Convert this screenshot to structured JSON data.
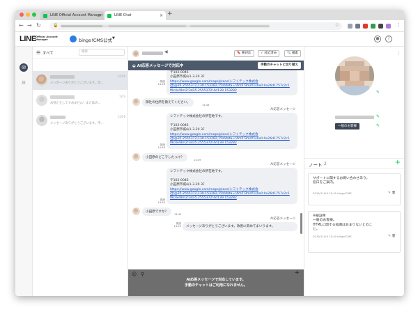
{
  "browser": {
    "tabs": [
      {
        "label": "LINE Official Account Manager"
      },
      {
        "label": "LINE Chat"
      }
    ],
    "new_tab_label": "+",
    "traffic_colors": [
      "#fe5f57",
      "#febc2e",
      "#28c840"
    ]
  },
  "app": {
    "logo": "LINE",
    "logo_sub_1": "Official Account",
    "logo_sub_2": "Manager",
    "account_name": "bingo!CMS公式",
    "account_caret": "▼",
    "accent": "#06c755"
  },
  "chat_list": {
    "filter_label": "すべて",
    "filter_caret": "▾",
    "search_placeholder": "検索",
    "items": [
      {
        "preview": "メッセージありがとうございます。改...",
        "time": "14:49",
        "selected": true
      },
      {
        "preview": "お待たせしてすみません！また私の...",
        "time": "12/3",
        "selected": false
      },
      {
        "preview": "メッセージありがとうございます。申...",
        "time": "11/26",
        "selected": false
      }
    ]
  },
  "chat": {
    "buttons": {
      "needs_action": "要対応",
      "done": "対応済み",
      "search": "検索"
    },
    "ai_bar_label": "AI応答メッセージで対応中",
    "switch_manual_label": "手動のチャットに切り替え",
    "ai_label": "AI応答メッセージ",
    "read_label": "既読",
    "messages": [
      {
        "lines": [
          "〒102-0045",
          "小田原市城山1-3-20 3F"
        ],
        "link": [
          "https://www.google.com/maps/place/シフトテック株式会",
          "社/@35.2555372,139.153282,15z/data=!4m5!3m4!1s0x0:0x26d1757c2c1",
          "f9c4e!8m2!3d35.2555372!4d139.153282"
        ],
        "time": "14:48"
      },
      {
        "user": true,
        "text": "御社の住所を教えてください。",
        "time": "14:48"
      },
      {
        "lines": [
          "シフトテック株式会社の所在地です。",
          "",
          "〒102-0045",
          "小田原市城山1-3-20 3F"
        ],
        "link": [
          "https://www.google.com/maps/place/シフトテック株式会",
          "社/@35.2555372,139.153282,15z/data=!4m5!3m4!1s0x0:0x26d1757c2c1",
          "f9c4e!8m2!3d35.2555372!4d139.153282"
        ],
        "time": "14:48"
      },
      {
        "user": true,
        "text": "小田原のどこでしたっけ？",
        "time": "14:49"
      },
      {
        "lines": [
          "シフトテック株式会社の所在地です。",
          "",
          "〒102-0045",
          "小田原市城山1-3-20 3F"
        ],
        "link": [
          "https://www.google.com/maps/place/シフトテック株式会",
          "社/@35.2555372,139.153282,15z/data=!4m5!3m4!1s0x0:0x26d1757c2c1",
          "f9c4e!8m2!3d35.2555372!4d139.153282"
        ],
        "time": "14:49"
      },
      {
        "user": true,
        "text": "小田原ですか？",
        "time": "14:49"
      },
      {
        "text": "メッセージありがとうございます。改善に努めてまいります。",
        "time": "14:49"
      }
    ],
    "input_notice_1": "AI応答メッセージで対応しています。",
    "input_notice_2": "手動のチャットはご利用になれません。"
  },
  "profile": {
    "tag": "一般のお客様",
    "note_title": "ノート",
    "note_count": "2",
    "add_label": "+",
    "notes": [
      {
        "lines": [
          "サポートに関するお問い合わせあり。",
          "窓口をご案内。"
        ],
        "meta": "2019/11/29 15:41  bingo!CMS"
      },
      {
        "lines": [
          "※検証用",
          "一般のお客様。",
          "HTMLに関する知識はあまりないとのこ",
          "と。"
        ],
        "meta": "2019/11/29 15:40  bingo!CMS"
      }
    ]
  }
}
